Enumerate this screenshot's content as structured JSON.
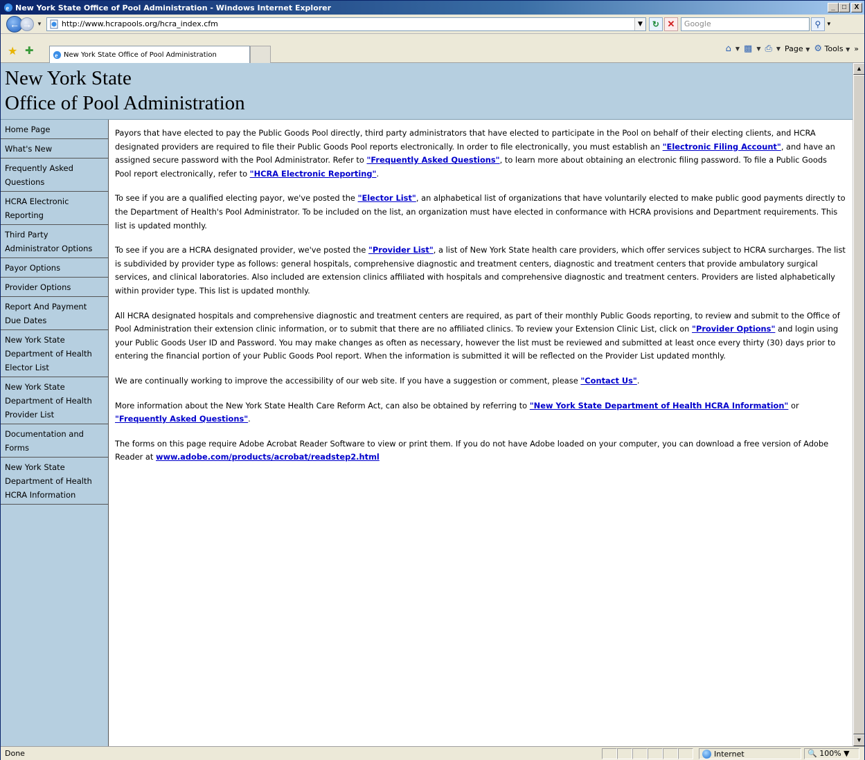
{
  "window": {
    "title": "New York State Office of Pool Administration - Windows Internet Explorer",
    "controls": [
      "_",
      "□",
      "X"
    ]
  },
  "toolbar": {
    "url": "http://www.hcrapools.org/hcra_index.cfm",
    "search_placeholder": "Google",
    "tab_title": "New York State Office of Pool Administration",
    "page_label": "Page",
    "tools_label": "Tools"
  },
  "banner": {
    "line1": "New York State",
    "line2": "Office of Pool Administration"
  },
  "sidebar": {
    "items": [
      {
        "label": "Home Page"
      },
      {
        "label": "What's New"
      },
      {
        "label": "Frequently Asked Questions"
      },
      {
        "label": "HCRA Electronic Reporting"
      },
      {
        "label": "Third Party Administrator Options"
      },
      {
        "label": "Payor Options"
      },
      {
        "label": "Provider Options"
      },
      {
        "label": "Report And Payment Due Dates"
      },
      {
        "label": "New York State Department of Health Elector List"
      },
      {
        "label": "New York State Department of Health Provider List"
      },
      {
        "label": "Documentation and Forms"
      },
      {
        "label": "New York State Department of Health HCRA Information"
      }
    ]
  },
  "content": {
    "p1": {
      "a": "Payors that have elected to pay the Public Goods Pool directly, third party administrators that have elected to participate in the Pool on behalf of their electing clients, and HCRA designated providers are required to file their Public Goods Pool reports electronically. In order to file electronically, you must establish an ",
      "link1": "\"Electronic Filing Account\"",
      "b": ",  and have an assigned secure password with the Pool Administrator. Refer to ",
      "link2": "\"Frequently Asked Questions\"",
      "c": ", to learn more about obtaining an electronic filing password. To file a Public Goods Pool report electronically, refer to ",
      "link3": "\"HCRA Electronic Reporting\"",
      "d": "."
    },
    "p2": {
      "a": "To see if you are a qualified electing payor, we've posted the ",
      "link1": "\"Elector List\"",
      "b": ", an alphabetical list of organizations that have voluntarily elected to make public good payments directly to the Department of Health's Pool Administrator. To be included on the list, an organization must have elected in conformance with HCRA provisions and Department requirements. This list is updated monthly."
    },
    "p3": {
      "a": "To see if you are a HCRA designated provider, we've posted the ",
      "link1": "\"Provider List\"",
      "b": ", a list of New York State health care providers, which offer services subject to HCRA surcharges. The list is subdivided by provider type as follows: general hospitals, comprehensive diagnostic and treatment centers, diagnostic and treatment centers that provide ambulatory surgical services, and clinical laboratories. Also included are extension clinics affiliated with hospitals and comprehensive diagnostic and treatment centers. Providers are listed alphabetically within provider type. This list is updated monthly."
    },
    "p4": {
      "a": "All HCRA designated hospitals and comprehensive diagnostic and treatment centers are required, as part of their monthly Public Goods reporting, to review and submit to the Office of Pool Administration their extension clinic information, or to submit that there are no affiliated clinics. To review your Extension Clinic List, click on ",
      "link1": "\"Provider Options\"",
      "b": " and login using your Public Goods User ID and Password. You may make changes as often as necessary, however the list must be reviewed and submitted at least once every thirty (30) days prior to entering the financial portion of your Public Goods Pool report. When the information is submitted it will be reflected on the Provider List updated monthly."
    },
    "p5": {
      "a": "We are continually working to improve the accessibility of our web site. If you have a suggestion or comment, please ",
      "link1": "\"Contact Us\"",
      "b": "."
    },
    "p6": {
      "a": "More information about the New York State Health Care Reform Act, can also be obtained by referring to ",
      "link1": "\"New York State Department of Health HCRA Information\"",
      "b": " or ",
      "link2": "\"Frequently Asked Questions\"",
      "c": "."
    },
    "p7": {
      "a": "The forms on this page require Adobe Acrobat Reader Software to view or print them. If you do not have Adobe loaded on your computer, you can download a free version of Adobe Reader at  ",
      "link1": "www.adobe.com/products/acrobat/readstep2.html"
    }
  },
  "statusbar": {
    "status": "Done",
    "zone": "Internet",
    "zoom": "100%"
  },
  "icons": [
    "ie-logo-icon",
    "back-arrow-icon",
    "forward-arrow-icon",
    "page-icon",
    "refresh-icon",
    "stop-icon",
    "search-icon",
    "favorites-star-icon",
    "add-favorites-icon",
    "home-icon",
    "feeds-icon",
    "print-icon",
    "globe-icon"
  ]
}
